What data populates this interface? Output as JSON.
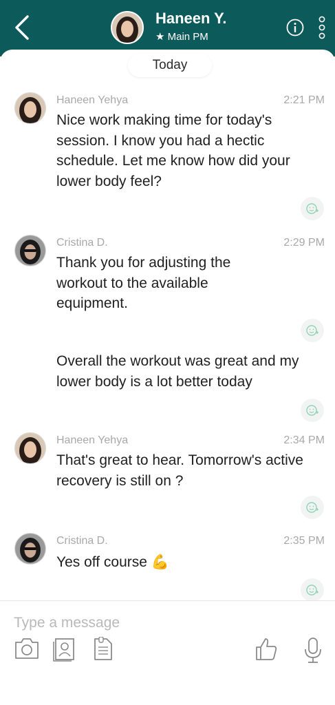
{
  "header": {
    "contact_name": "Haneen Y.",
    "subtitle": "★ Main PM",
    "icons": [
      "back-chevron-icon",
      "info-icon",
      "more-vertical-icon"
    ],
    "background_color": "#0d5a5b"
  },
  "date_divider": "Today",
  "messages": [
    {
      "sender": "Haneen Yehya",
      "time": "2:21 PM",
      "text": "Nice work making time for today's session. I know you had a hectic schedule. Let me know how did your lower body feel?"
    },
    {
      "sender": "Cristina D.",
      "time": "2:29 PM",
      "text": "Thank you for adjusting the workout to the available equipment."
    },
    {
      "sender": "",
      "time": "",
      "text": "Overall the workout was great and my lower body is a lot better today"
    },
    {
      "sender": "Haneen Yehya",
      "time": "2:34 PM",
      "text": "That's great to hear. Tomorrow's active recovery is still on ?"
    },
    {
      "sender": "Cristina D.",
      "time": "2:35 PM",
      "text": "Yes off course 💪"
    }
  ],
  "composer": {
    "placeholder": "Type a message",
    "tools": [
      "camera-icon",
      "contact-card-icon",
      "document-icon",
      "thumbs-up-icon",
      "microphone-icon"
    ]
  }
}
